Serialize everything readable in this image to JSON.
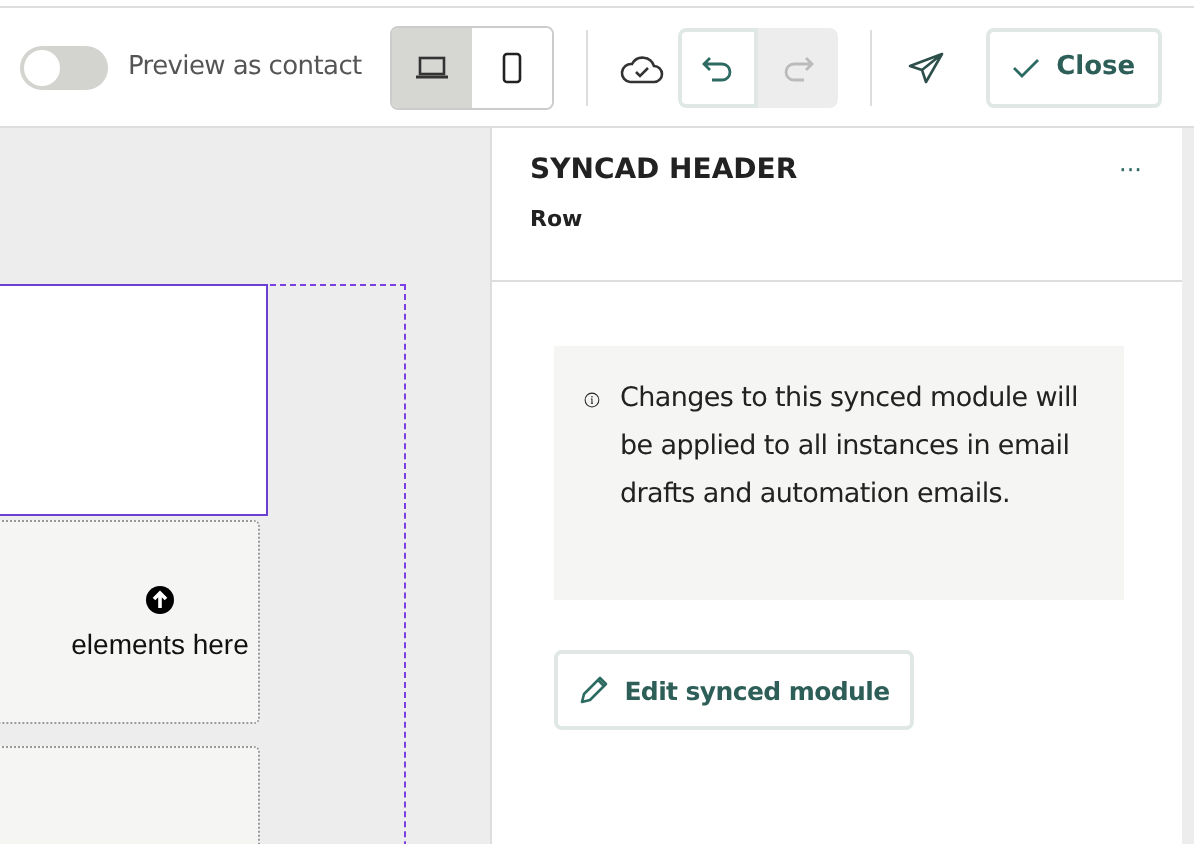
{
  "toolbar": {
    "preview_toggle": {
      "label": "Preview as contact",
      "on": false
    },
    "devices": [
      {
        "kind": "desktop",
        "selected": true
      },
      {
        "kind": "mobile",
        "selected": false
      }
    ],
    "history": [
      {
        "kind": "undo",
        "disabled": false
      },
      {
        "kind": "redo",
        "disabled": true
      }
    ],
    "close_button": "Close"
  },
  "canvas": {
    "drop_zone_text": "elements here"
  },
  "panel": {
    "title": "SYNCAD HEADER",
    "more": "···",
    "subtitle": "Row",
    "notice": "Changes to this synced module will be applied to all instances in email drafts and automation emails.",
    "edit_button": "Edit synced module"
  }
}
